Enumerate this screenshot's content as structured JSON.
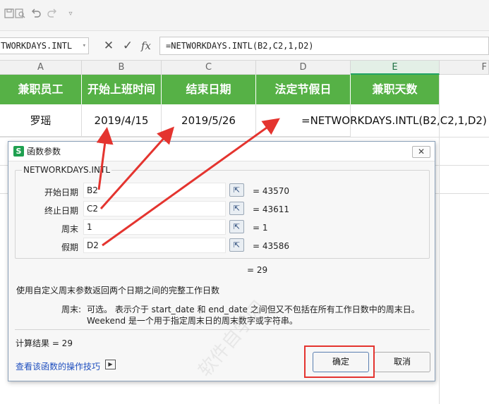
{
  "quick_access": {
    "icons": [
      "save-icon",
      "print-preview-icon",
      "undo-icon",
      "redo-icon",
      "customize-dropdown-icon"
    ]
  },
  "formula_bar": {
    "name_box": "TWORKDAYS.INTL",
    "cancel_glyph": "✕",
    "confirm_glyph": "✓",
    "fx_glyph": "fx",
    "formula": "=NETWORKDAYS.INTL(B2,C2,1,D2)"
  },
  "sheet": {
    "columns": [
      "A",
      "B",
      "C",
      "D",
      "E",
      "F"
    ],
    "selected_column": "E",
    "header_row": [
      "兼职员工",
      "开始上班时间",
      "结束日期",
      "法定节假日",
      "兼职天数"
    ],
    "row2": {
      "A": "罗瑶",
      "B": "2019/4/15",
      "C": "2019/5/26",
      "D": "",
      "E_formula": "=NETWORKDAYS.INTL(B2,C2,1,D2)"
    },
    "header_color": "#56b146"
  },
  "dialog": {
    "title": "函数参数",
    "close_glyph": "✕",
    "function_name": "NETWORKDAYS.INTL",
    "args": [
      {
        "label": "开始日期",
        "value": "B2",
        "result": "= 43570"
      },
      {
        "label": "终止日期",
        "value": "C2",
        "result": "= 43611"
      },
      {
        "label": "周末",
        "value": "1",
        "result": "= 1"
      },
      {
        "label": "假期",
        "value": "D2",
        "result": "= 43586"
      }
    ],
    "overall_result": "= 29",
    "description": "使用自定义周末参数返回两个日期之间的完整工作日数",
    "param_name": "周末:",
    "param_help_line1": "可选。 表示介于 start_date 和 end_date 之间但又不包括在所有工作日数中的周末日。",
    "param_help_line2": "Weekend 是一个用于指定周末日的周末数字或字符串。",
    "calc_result": "计算结果 = 29",
    "help_link": "查看该函数的操作技巧",
    "ok_label": "确定",
    "cancel_label": "取消"
  },
  "watermark": "软件自学网",
  "colors": {
    "annotation_red": "#e4342f",
    "header_green": "#56b146",
    "link_blue": "#1f4fbf"
  }
}
